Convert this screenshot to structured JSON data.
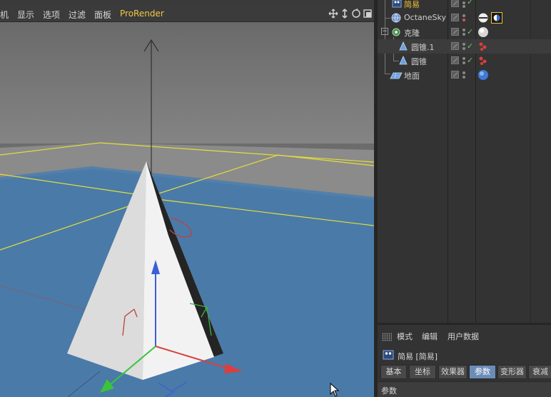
{
  "viewport": {
    "menus": [
      "机",
      "显示",
      "选项",
      "过滤",
      "面板",
      "ProRender"
    ],
    "nav_icons": [
      "move-view-icon",
      "dolly-view-icon",
      "rotate-view-icon",
      "toggle-view-icon"
    ]
  },
  "object_manager": {
    "objects": [
      {
        "name": "简易",
        "icon": "simple-deformer-icon",
        "active": true
      },
      {
        "name": "OctaneSky",
        "icon": "octane-sky-icon",
        "active": false
      },
      {
        "name": "克隆",
        "icon": "cloner-icon",
        "active": false
      },
      {
        "name": "圆锥.1",
        "icon": "cone-icon",
        "active": false
      },
      {
        "name": "圆锥",
        "icon": "cone-icon",
        "active": false
      },
      {
        "name": "地面",
        "icon": "floor-icon",
        "active": false
      }
    ]
  },
  "attribute_manager": {
    "menus": [
      "模式",
      "编辑",
      "用户数据"
    ],
    "object_label": "简易 [简易]",
    "tabs": [
      "基本",
      "坐标",
      "效果器",
      "参数",
      "变形器",
      "衰减"
    ],
    "active_tab": "参数",
    "section_label": "参数"
  },
  "colors": {
    "accent": "#f2c130",
    "active_tab": "#6c8cb8",
    "prorender": "#f0c940",
    "floor": "#4a7aa8"
  }
}
